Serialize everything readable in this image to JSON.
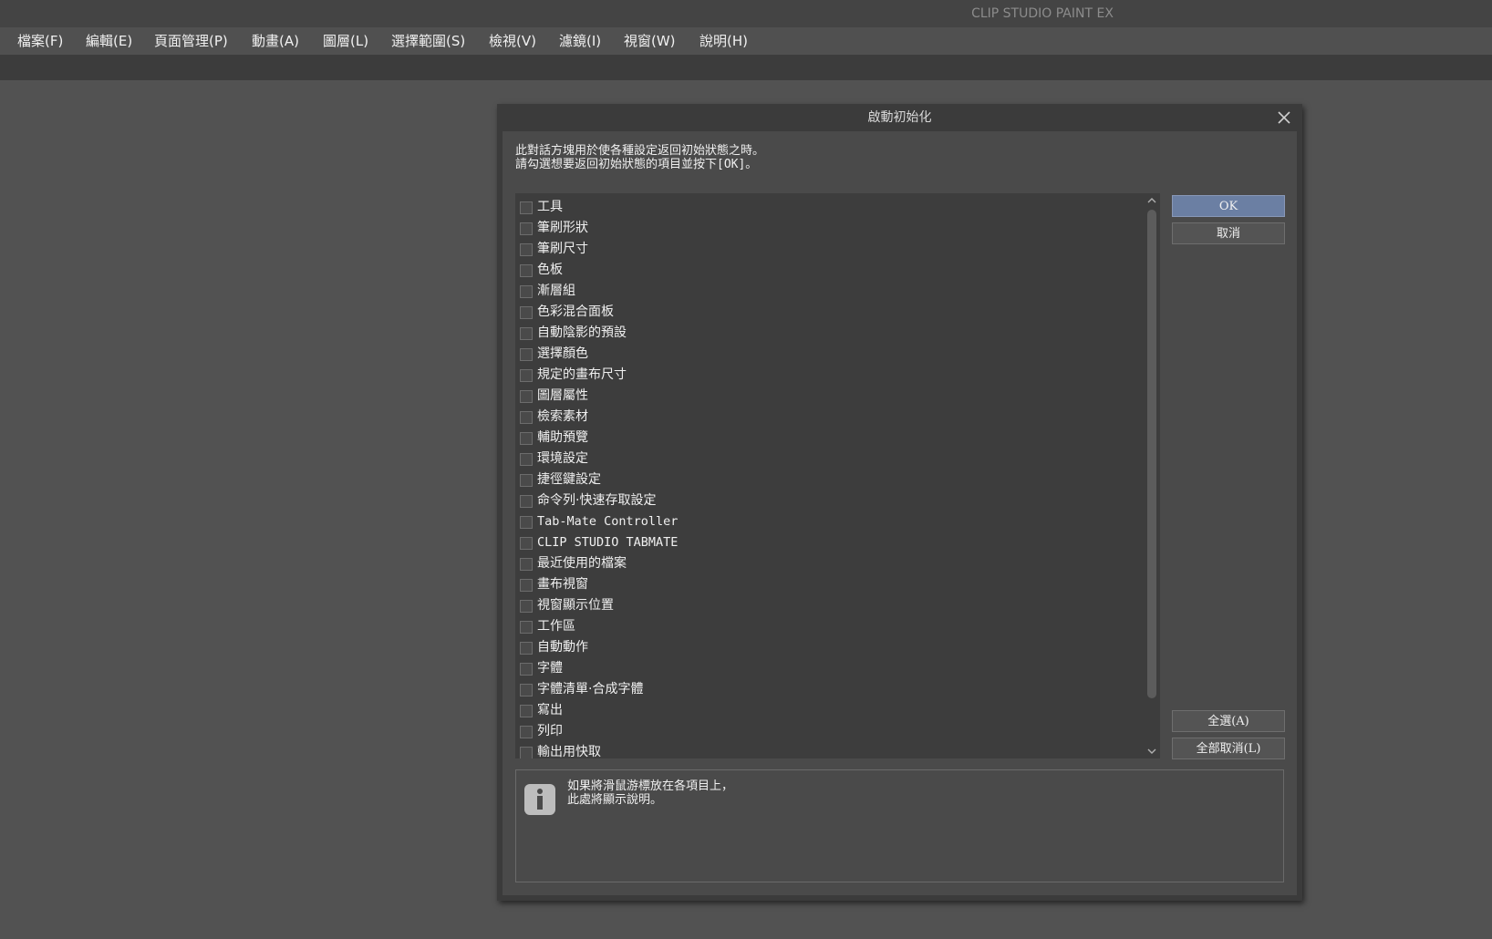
{
  "app": {
    "title": "CLIP STUDIO PAINT EX"
  },
  "menu": [
    {
      "label": "檔案(F)"
    },
    {
      "label": "編輯(E)"
    },
    {
      "label": "頁面管理(P)"
    },
    {
      "label": "動畫(A)"
    },
    {
      "label": "圖層(L)"
    },
    {
      "label": "選擇範圍(S)"
    },
    {
      "label": "檢視(V)"
    },
    {
      "label": "濾鏡(I)"
    },
    {
      "label": "視窗(W)"
    },
    {
      "label": "說明(H)"
    }
  ],
  "dialog": {
    "title": "啟動初始化",
    "instructions_line1": "此對話方塊用於使各種設定返回初始狀態之時。",
    "instructions_line2": "請勾選想要返回初始狀態的項目並按下[OK]。",
    "items": [
      {
        "label": "工具",
        "checked": false
      },
      {
        "label": "筆刷形狀",
        "checked": false
      },
      {
        "label": "筆刷尺寸",
        "checked": false
      },
      {
        "label": "色板",
        "checked": false
      },
      {
        "label": "漸層組",
        "checked": false
      },
      {
        "label": "色彩混合面板",
        "checked": false
      },
      {
        "label": "自動陰影的預設",
        "checked": false
      },
      {
        "label": "選擇顏色",
        "checked": false
      },
      {
        "label": "規定的畫布尺寸",
        "checked": false
      },
      {
        "label": "圖層屬性",
        "checked": false
      },
      {
        "label": "檢索素材",
        "checked": false
      },
      {
        "label": "輔助預覽",
        "checked": false
      },
      {
        "label": "環境設定",
        "checked": false
      },
      {
        "label": "捷徑鍵設定",
        "checked": false
      },
      {
        "label": "命令列·快速存取設定",
        "checked": false
      },
      {
        "label": "Tab-Mate Controller",
        "checked": false
      },
      {
        "label": "CLIP STUDIO TABMATE",
        "checked": false
      },
      {
        "label": "最近使用的檔案",
        "checked": false
      },
      {
        "label": "畫布視窗",
        "checked": false
      },
      {
        "label": "視窗顯示位置",
        "checked": false
      },
      {
        "label": "工作區",
        "checked": false
      },
      {
        "label": "自動動作",
        "checked": false
      },
      {
        "label": "字體",
        "checked": false
      },
      {
        "label": "字體清單·合成字體",
        "checked": false
      },
      {
        "label": "寫出",
        "checked": false
      },
      {
        "label": "列印",
        "checked": false
      },
      {
        "label": "輸出用快取",
        "checked": false
      }
    ],
    "ok_label": "OK",
    "cancel_label": "取消",
    "select_all_label": "全選(A)",
    "deselect_all_label": "全部取消(L)",
    "info_line1": "如果將滑鼠游標放在各項目上，",
    "info_line2": "此處將顯示說明。"
  },
  "colors": {
    "primary_button": "#6b7fa3",
    "background": "#525252"
  }
}
